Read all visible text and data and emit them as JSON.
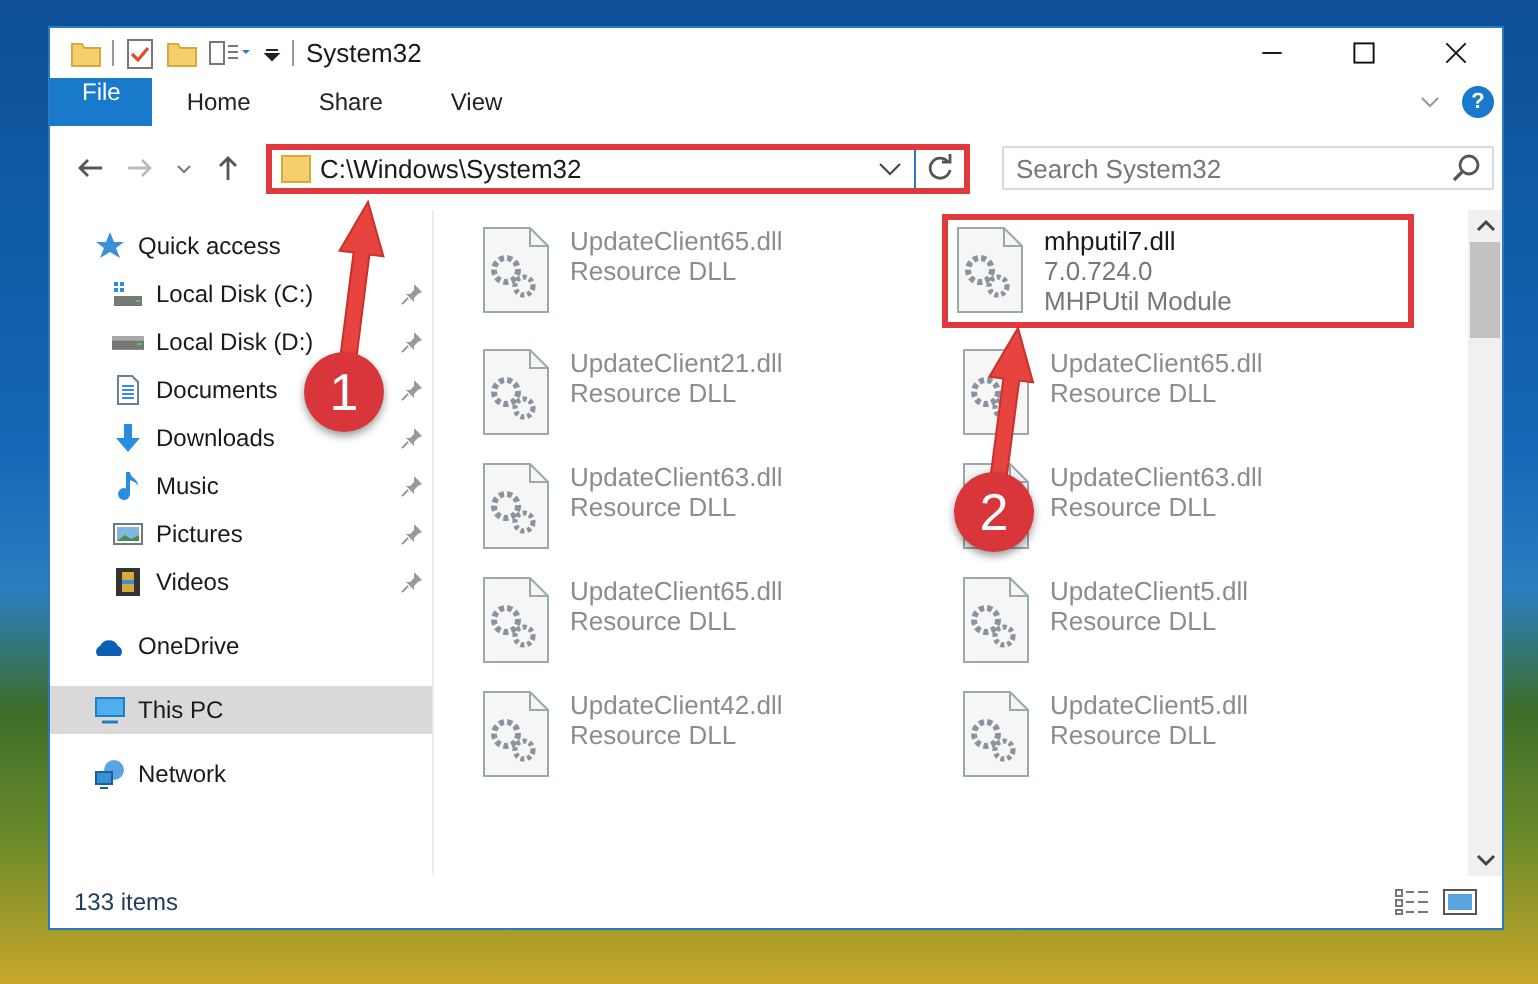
{
  "window": {
    "title": "System32"
  },
  "help_label": "?",
  "ribbon_tabs": [
    {
      "label": "File",
      "kind": "file"
    },
    {
      "label": "Home",
      "kind": "tab"
    },
    {
      "label": "Share",
      "kind": "tab"
    },
    {
      "label": "View",
      "kind": "tab"
    }
  ],
  "address_bar": {
    "path": "C:\\Windows\\System32",
    "highlighted": true
  },
  "search": {
    "placeholder": "Search System32"
  },
  "sidebar": {
    "items": [
      {
        "label": "Quick access",
        "selected": false,
        "children": [
          {
            "label": "Local Disk (C:)",
            "pinned": true
          },
          {
            "label": "Local Disk (D:)",
            "pinned": true
          },
          {
            "label": "Documents",
            "pinned": true
          },
          {
            "label": "Downloads",
            "pinned": true
          },
          {
            "label": "Music",
            "pinned": true
          },
          {
            "label": "Pictures",
            "pinned": true
          },
          {
            "label": "Videos",
            "pinned": true
          }
        ]
      },
      {
        "label": "OneDrive",
        "selected": false
      },
      {
        "label": "This PC",
        "selected": true
      },
      {
        "label": "Network",
        "selected": false
      }
    ]
  },
  "files": [
    {
      "name": "UpdateClient65.dll",
      "lines": [
        "Resource DLL"
      ],
      "dimmed": true,
      "highlighted": false
    },
    {
      "name": "mhputil7.dll",
      "lines": [
        "7.0.724.0",
        "MHPUtil Module"
      ],
      "dimmed": false,
      "highlighted": true
    },
    {
      "name": "UpdateClient21.dll",
      "lines": [
        "Resource DLL"
      ],
      "dimmed": true,
      "highlighted": false
    },
    {
      "name": "UpdateClient65.dll",
      "lines": [
        "Resource DLL"
      ],
      "dimmed": true,
      "highlighted": false
    },
    {
      "name": "UpdateClient63.dll",
      "lines": [
        "Resource DLL"
      ],
      "dimmed": true,
      "highlighted": false
    },
    {
      "name": "UpdateClient63.dll",
      "lines": [
        "Resource DLL"
      ],
      "dimmed": true,
      "highlighted": false
    },
    {
      "name": "UpdateClient65.dll",
      "lines": [
        "Resource DLL"
      ],
      "dimmed": true,
      "highlighted": false
    },
    {
      "name": "UpdateClient5.dll",
      "lines": [
        "Resource DLL"
      ],
      "dimmed": true,
      "highlighted": false
    },
    {
      "name": "UpdateClient42.dll",
      "lines": [
        "Resource DLL"
      ],
      "dimmed": true,
      "highlighted": false
    },
    {
      "name": "UpdateClient5.dll",
      "lines": [
        "Resource DLL"
      ],
      "dimmed": true,
      "highlighted": false
    }
  ],
  "status_bar": {
    "item_count": "133 items"
  },
  "callouts": [
    {
      "label": "1"
    },
    {
      "label": "2"
    }
  ]
}
